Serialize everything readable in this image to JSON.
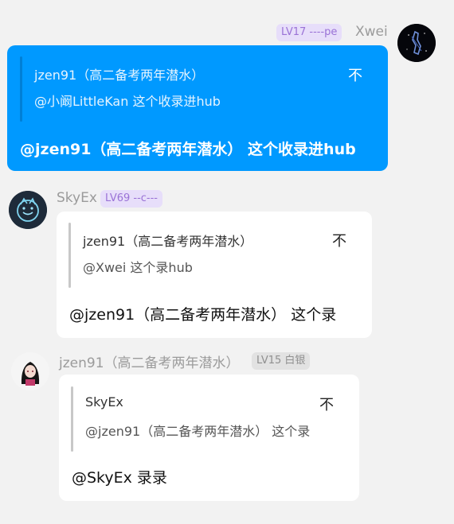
{
  "messages": [
    {
      "sender": "Xwei",
      "badge": "LV17 ----pe",
      "quote": {
        "author": "jzen91（高二备考两年潜水）",
        "text": "@小阚LittleKan 这个收录进hub",
        "more_icon": "不"
      },
      "text": "@jzen91（高二备考两年潜水） 这个收录进hub"
    },
    {
      "sender": "SkyEx",
      "badge": "LV69 --c---",
      "quote": {
        "author": "jzen91（高二备考两年潜水）",
        "text": "@Xwei 这个录hub",
        "more_icon": "不"
      },
      "text": "@jzen91（高二备考两年潜水） 这个录"
    },
    {
      "sender": "jzen91（高二备考两年潜水）",
      "badge": "LV15 白银",
      "quote": {
        "author": "SkyEx",
        "text": "@jzen91（高二备考两年潜水） 这个录",
        "more_icon": "不"
      },
      "text": "@SkyEx 录录"
    }
  ],
  "colors": {
    "background": "#f2f2f2",
    "own_bubble": "#0099ff",
    "other_bubble": "#ffffff",
    "badge_purple_bg": "#e7defa",
    "badge_purple_text": "#9a72d6",
    "badge_gray_bg": "#e2e2e2"
  }
}
